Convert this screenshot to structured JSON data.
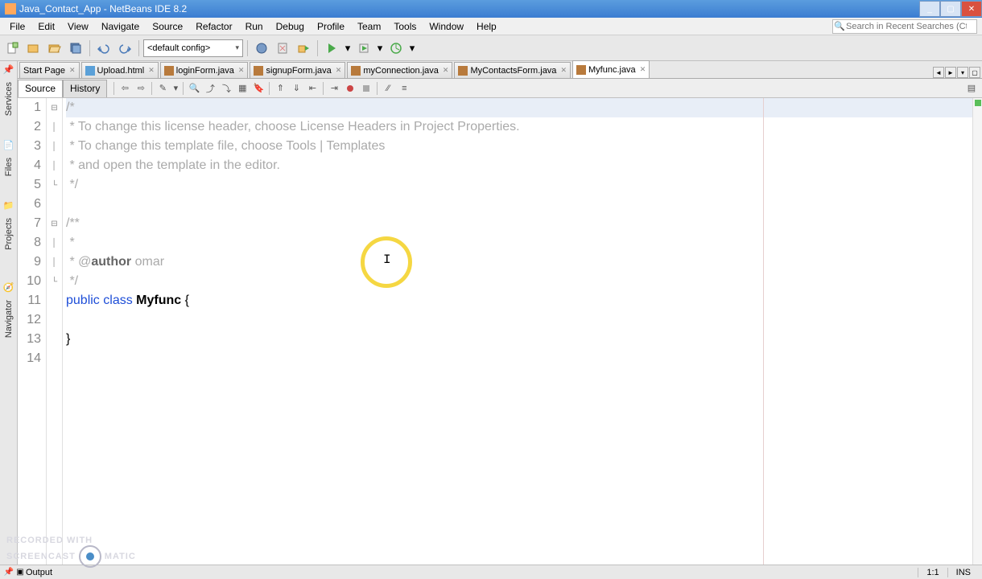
{
  "title": "Java_Contact_App - NetBeans IDE 8.2",
  "menu": [
    "File",
    "Edit",
    "View",
    "Navigate",
    "Source",
    "Refactor",
    "Run",
    "Debug",
    "Profile",
    "Team",
    "Tools",
    "Window",
    "Help"
  ],
  "search_placeholder": "Search in Recent Searches (Ctrl+I)",
  "config_combo": "<default config>",
  "side_labels": [
    "Services",
    "Files",
    "Projects",
    "Navigator"
  ],
  "tabs": [
    {
      "label": "Start Page",
      "icon": "start",
      "closable": true
    },
    {
      "label": "Upload.html",
      "icon": "html",
      "closable": true
    },
    {
      "label": "loginForm.java",
      "icon": "java",
      "closable": true
    },
    {
      "label": "signupForm.java",
      "icon": "java",
      "closable": true
    },
    {
      "label": "myConnection.java",
      "icon": "java",
      "closable": true
    },
    {
      "label": "MyContactsForm.java",
      "icon": "java",
      "closable": true
    },
    {
      "label": "Myfunc.java",
      "icon": "java",
      "closable": true,
      "active": true
    }
  ],
  "src_tabs": {
    "source": "Source",
    "history": "History"
  },
  "code_lines": [
    "/*",
    " * To change this license header, choose License Headers in Project Properties.",
    " * To change this template file, choose Tools | Templates",
    " * and open the template in the editor.",
    " */",
    "",
    "/**",
    " *",
    " * @author omar",
    " */",
    "public class Myfunc {",
    "    ",
    "}",
    ""
  ],
  "status": {
    "output": "Output",
    "pos": "1:1",
    "ins": "INS"
  },
  "watermark": {
    "l1": "RECORDED WITH",
    "l2": "SCREENCAST",
    "l3": "MATIC"
  }
}
